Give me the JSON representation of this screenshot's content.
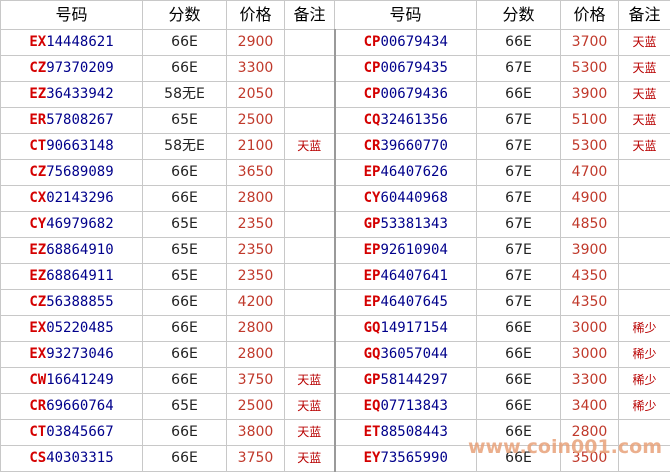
{
  "headers": [
    "号码",
    "分数",
    "价格",
    "备注",
    "号码",
    "分数",
    "价格",
    "备注"
  ],
  "rows": [
    {
      "left": {
        "prefix": "EX",
        "number": "14448621",
        "grade": "66E",
        "price": "2900",
        "note": ""
      },
      "right": {
        "prefix": "CP",
        "number": "00679434",
        "grade": "66E",
        "price": "3700",
        "note": "天蓝"
      }
    },
    {
      "left": {
        "prefix": "CZ",
        "number": "97370209",
        "grade": "66E",
        "price": "3300",
        "note": ""
      },
      "right": {
        "prefix": "CP",
        "number": "00679435",
        "grade": "67E",
        "price": "5300",
        "note": "天蓝"
      }
    },
    {
      "left": {
        "prefix": "EZ",
        "number": "36433942",
        "grade": "58无E",
        "price": "2050",
        "note": ""
      },
      "right": {
        "prefix": "CP",
        "number": "00679436",
        "grade": "66E",
        "price": "3900",
        "note": "天蓝"
      }
    },
    {
      "left": {
        "prefix": "ER",
        "number": "57808267",
        "grade": "65E",
        "price": "2500",
        "note": ""
      },
      "right": {
        "prefix": "CQ",
        "number": "32461356",
        "grade": "67E",
        "price": "5100",
        "note": "天蓝"
      }
    },
    {
      "left": {
        "prefix": "CT",
        "number": "90663148",
        "grade": "58无E",
        "price": "2100",
        "note": "天蓝"
      },
      "right": {
        "prefix": "CR",
        "number": "39660770",
        "grade": "67E",
        "price": "5300",
        "note": "天蓝"
      }
    },
    {
      "left": {
        "prefix": "CZ",
        "number": "75689089",
        "grade": "66E",
        "price": "3650",
        "note": ""
      },
      "right": {
        "prefix": "EP",
        "number": "46407626",
        "grade": "67E",
        "price": "4700",
        "note": ""
      }
    },
    {
      "left": {
        "prefix": "CX",
        "number": "02143296",
        "grade": "66E",
        "price": "2800",
        "note": ""
      },
      "right": {
        "prefix": "CY",
        "number": "60440968",
        "grade": "67E",
        "price": "4900",
        "note": ""
      }
    },
    {
      "left": {
        "prefix": "CY",
        "number": "46979682",
        "grade": "65E",
        "price": "2350",
        "note": ""
      },
      "right": {
        "prefix": "GP",
        "number": "53381343",
        "grade": "67E",
        "price": "4850",
        "note": ""
      }
    },
    {
      "left": {
        "prefix": "EZ",
        "number": "68864910",
        "grade": "65E",
        "price": "2350",
        "note": ""
      },
      "right": {
        "prefix": "EP",
        "number": "92610904",
        "grade": "67E",
        "price": "3900",
        "note": ""
      }
    },
    {
      "left": {
        "prefix": "EZ",
        "number": "68864911",
        "grade": "65E",
        "price": "2350",
        "note": ""
      },
      "right": {
        "prefix": "EP",
        "number": "46407641",
        "grade": "67E",
        "price": "4350",
        "note": ""
      }
    },
    {
      "left": {
        "prefix": "CZ",
        "number": "56388855",
        "grade": "66E",
        "price": "4200",
        "note": ""
      },
      "right": {
        "prefix": "EP",
        "number": "46407645",
        "grade": "67E",
        "price": "4350",
        "note": ""
      }
    },
    {
      "left": {
        "prefix": "EX",
        "number": "05220485",
        "grade": "66E",
        "price": "2800",
        "note": ""
      },
      "right": {
        "prefix": "GQ",
        "number": "14917154",
        "grade": "66E",
        "price": "3000",
        "note": "稀少"
      }
    },
    {
      "left": {
        "prefix": "EX",
        "number": "93273046",
        "grade": "66E",
        "price": "2800",
        "note": ""
      },
      "right": {
        "prefix": "GQ",
        "number": "36057044",
        "grade": "66E",
        "price": "3000",
        "note": "稀少"
      }
    },
    {
      "left": {
        "prefix": "CW",
        "number": "16641249",
        "grade": "66E",
        "price": "3750",
        "note": "天蓝"
      },
      "right": {
        "prefix": "GP",
        "number": "58144297",
        "grade": "66E",
        "price": "3300",
        "note": "稀少"
      }
    },
    {
      "left": {
        "prefix": "CR",
        "number": "69660764",
        "grade": "65E",
        "price": "2500",
        "note": "天蓝"
      },
      "right": {
        "prefix": "EQ",
        "number": "07713843",
        "grade": "66E",
        "price": "3400",
        "note": "稀少"
      }
    },
    {
      "left": {
        "prefix": "CT",
        "number": "03845667",
        "grade": "66E",
        "price": "3800",
        "note": "天蓝"
      },
      "right": {
        "prefix": "ET",
        "number": "88508443",
        "grade": "66E",
        "price": "2800",
        "note": ""
      }
    },
    {
      "left": {
        "prefix": "CS",
        "number": "40303315",
        "grade": "66E",
        "price": "3750",
        "note": "天蓝"
      },
      "right": {
        "prefix": "EY",
        "number": "73565990",
        "grade": "66E",
        "price": "3500",
        "note": ""
      }
    }
  ],
  "watermark": "www.coin001.com",
  "colors": {
    "prefix": "#d40000",
    "number": "#00008b",
    "price": "#c0392b",
    "note": "#b80000",
    "watermark": "#e8a27a"
  }
}
